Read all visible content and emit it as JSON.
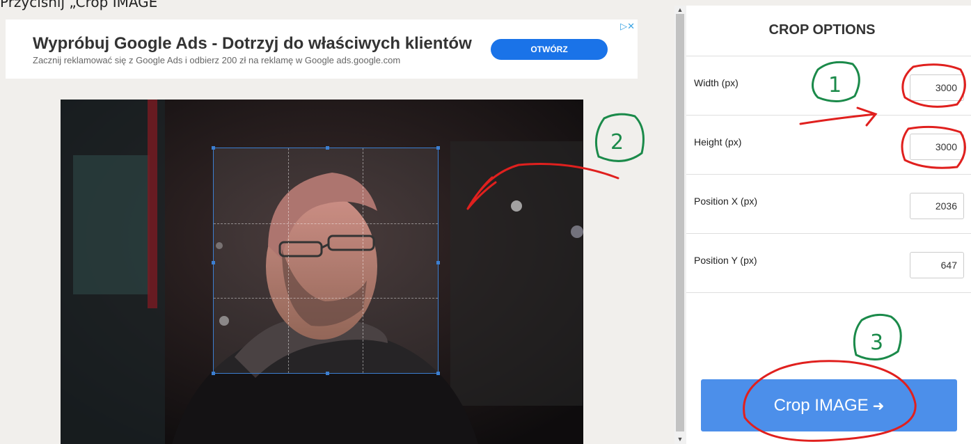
{
  "page": {
    "top_cut_text": "Przyciśnij „Crop IMAGE”"
  },
  "ad": {
    "title": "Wypróbuj Google Ads - Dotrzyj do właściwych klientów",
    "subtitle": "Zacznij reklamować się z Google Ads i odbierz 200 zł na reklamę w Google ads.google.com",
    "button_label": "OTWÓRZ",
    "choice_icon": "▷✕"
  },
  "photo": {
    "description_icon": "photo-of-man"
  },
  "panel": {
    "title": "CROP OPTIONS",
    "fields": [
      {
        "label": "Width (px)",
        "value": "3000"
      },
      {
        "label": "Height (px)",
        "value": "3000"
      },
      {
        "label": "Position X (px)",
        "value": "2036"
      },
      {
        "label": "Position Y (px)",
        "value": "647"
      }
    ],
    "crop_button_label": "Crop IMAGE",
    "crop_button_icon": "➜"
  },
  "annotations": {
    "step1": "1",
    "step2": "2",
    "step3": "3"
  },
  "colors": {
    "accent": "#4c8fea",
    "ad_button": "#1a73e8",
    "annotation_red": "#e0201e",
    "annotation_green": "#1b8a4a"
  }
}
